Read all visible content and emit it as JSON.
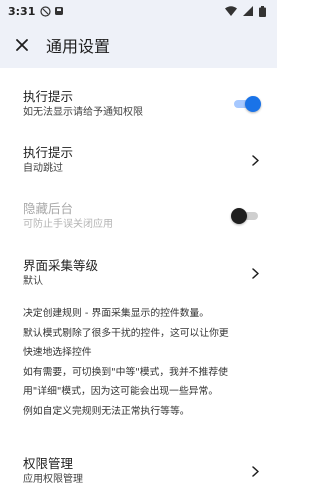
{
  "status_bar": {
    "time": "3:31",
    "icons": [
      "vpn-circle-icon",
      "notification-square-icon",
      "wifi-icon",
      "signal-icon",
      "battery-icon"
    ]
  },
  "app_bar": {
    "close_icon": "close-icon",
    "title": "通用设置"
  },
  "settings": {
    "exec_prompt_toggle": {
      "label": "执行提示",
      "sub": "如无法显示请给予通知权限",
      "enabled": true
    },
    "exec_prompt_mode": {
      "label": "执行提示",
      "sub": "自动跳过"
    },
    "hide_background": {
      "label": "隐藏后台",
      "sub": "可防止手误关闭应用",
      "enabled": false,
      "disabled": true
    },
    "ui_collect_level": {
      "label": "界面采集等级",
      "sub": "默认"
    },
    "ui_collect_desc": {
      "line1": "决定创建规则 - 界面采集显示的控件数量。",
      "line2": "默认模式剔除了很多干扰的控件，这可以让你更",
      "line3": "快速地选择控件",
      "line4": "如有需要，可切换到\"中等\"模式，我并不推荐使",
      "line5": "用\"详细\"模式，因为这可能会出现一些异常。",
      "line6": "例如自定义完规则无法正常执行等等。"
    },
    "permissions": {
      "label": "权限管理",
      "sub": "应用权限管理"
    }
  },
  "colors": {
    "accent": "#1a73e8",
    "header_bg": "#eef1f8"
  }
}
